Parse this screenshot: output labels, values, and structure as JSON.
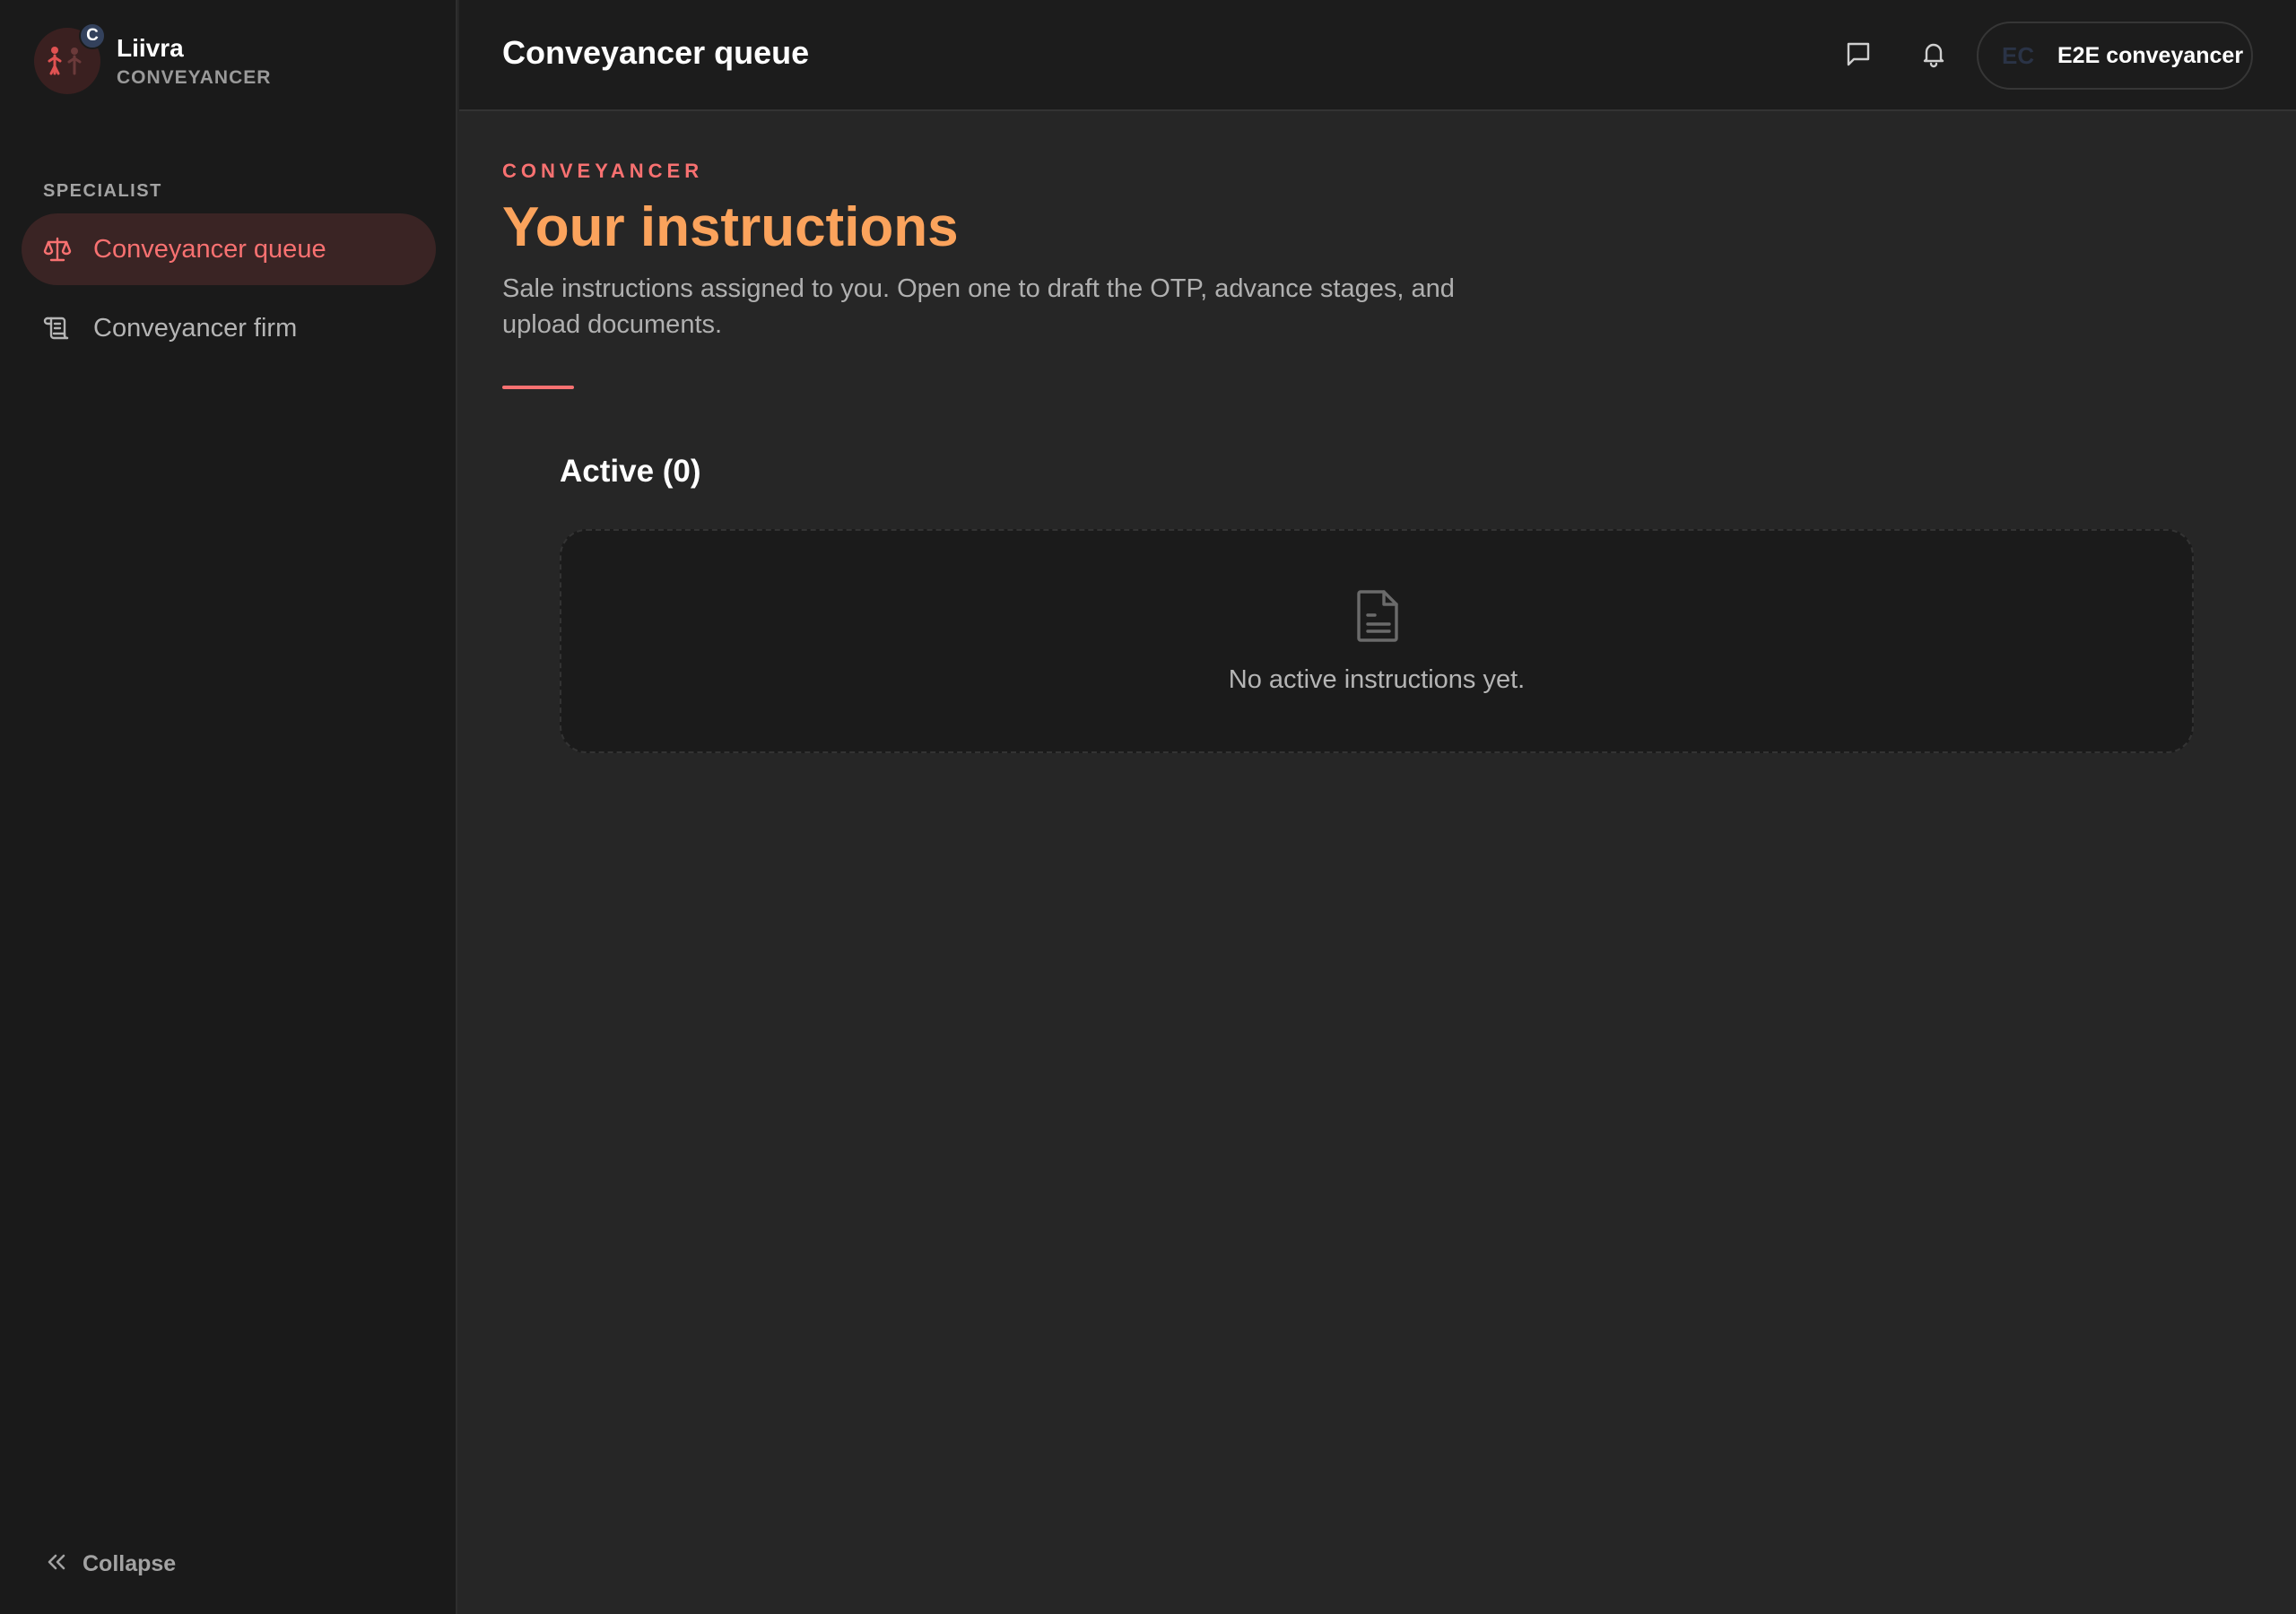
{
  "brand": {
    "name": "Liivra",
    "role": "CONVEYANCER",
    "badge": "C",
    "logo_icon": "couple-logo-icon"
  },
  "sidebar": {
    "section_label": "SPECIALIST",
    "items": [
      {
        "label": "Conveyancer queue",
        "icon": "scale-icon",
        "active": true
      },
      {
        "label": "Conveyancer firm",
        "icon": "scroll-icon",
        "active": false
      }
    ],
    "collapse_label": "Collapse",
    "collapse_icon": "chevrons-left-icon"
  },
  "header": {
    "title": "Conveyancer queue",
    "icons": [
      "message-icon",
      "bell-icon"
    ],
    "user": {
      "initials": "EC",
      "name": "E2E conveyancer"
    }
  },
  "main": {
    "eyebrow": "CONVEYANCER",
    "heading": "Your instructions",
    "description": "Sale instructions assigned to you. Open one to draft the OTP, advance stages, and upload documents.",
    "section_title": "Active (0)",
    "empty_state": {
      "icon": "document-icon",
      "text": "No active instructions yet."
    }
  },
  "colors": {
    "accent": "#f87171",
    "heading": "#fba35c",
    "background": "#262626",
    "sidebar": "#1a1a1a"
  }
}
